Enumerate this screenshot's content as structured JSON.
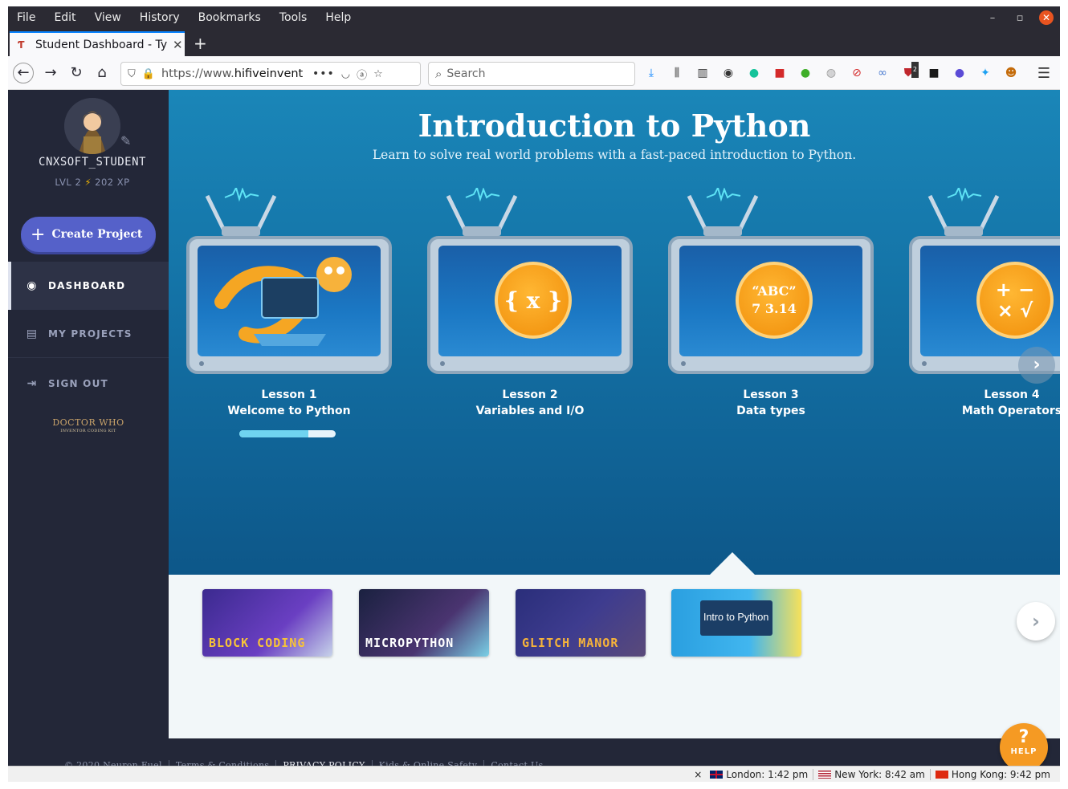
{
  "browser": {
    "menu": [
      "File",
      "Edit",
      "View",
      "History",
      "Bookmarks",
      "Tools",
      "Help"
    ],
    "tab_title": "Student Dashboard - Tyn",
    "url_prefix": "https://www.",
    "url_domain": "hifiveinvent",
    "search_placeholder": "Search",
    "toolbar_icons": [
      "download-icon",
      "library-icon",
      "sidebar-icon",
      "account-icon",
      "grammarly-icon",
      "pdf-icon",
      "chat-icon",
      "globe-icon",
      "block-icon",
      "link-icon",
      "ublock-icon",
      "extension-icon",
      "earth-icon",
      "twitter-icon",
      "tampermonkey-icon"
    ],
    "ublock_badge": "2"
  },
  "sidebar": {
    "username": "CNXSOFT_STUDENT",
    "level": "LVL 2",
    "xp": "202 XP",
    "create_label": "Create Project",
    "nav": [
      {
        "label": "DASHBOARD",
        "icon": "compass-icon"
      },
      {
        "label": "MY PROJECTS",
        "icon": "projects-icon"
      },
      {
        "label": "SIGN OUT",
        "icon": "sign-out-icon"
      }
    ],
    "brand_logo": "DOCTOR WHO",
    "brand_sub": "INVENTOR CODING KIT"
  },
  "course": {
    "title": "Introduction to Python",
    "subtitle": "Learn to solve real world problems with a fast-paced introduction to Python.",
    "lessons": [
      {
        "number": "Lesson 1",
        "name": "Welcome to Python",
        "icon": "python-snake-icon",
        "progress": 0.72
      },
      {
        "number": "Lesson 2",
        "name": "Variables and I/O",
        "icon": "variable-icon",
        "coin": "{ x }"
      },
      {
        "number": "Lesson 3",
        "name": "Data types",
        "icon": "data-types-icon",
        "coin_top": "“ABC”",
        "coin_bottom": "7  3.14"
      },
      {
        "number": "Lesson 4",
        "name": "Math Operators",
        "icon": "math-operators-icon",
        "coin_top": "+  −",
        "coin_bottom": "×  √"
      }
    ]
  },
  "courses": [
    {
      "label": "BLOCK CODING"
    },
    {
      "label": "MICROPYTHON"
    },
    {
      "label": "GLITCH MANOR"
    },
    {
      "label": "Intro to Python"
    }
  ],
  "footer": {
    "copyright": "© 2020 Neuron Fuel",
    "links": [
      "Terms & Conditions",
      "PRIVACY POLICY",
      "Kids & Online Safety",
      "Contact Us"
    ],
    "help": "HELP"
  },
  "clocks": [
    {
      "label": "London: 1:42 pm"
    },
    {
      "label": "New York: 8:42 am"
    },
    {
      "label": "Hong Kong: 9:42 pm"
    }
  ],
  "colors": {
    "sidebar": "#232738",
    "hero": "#136fa3",
    "accent_button": "#5561c9",
    "coin": "#f59a23"
  }
}
